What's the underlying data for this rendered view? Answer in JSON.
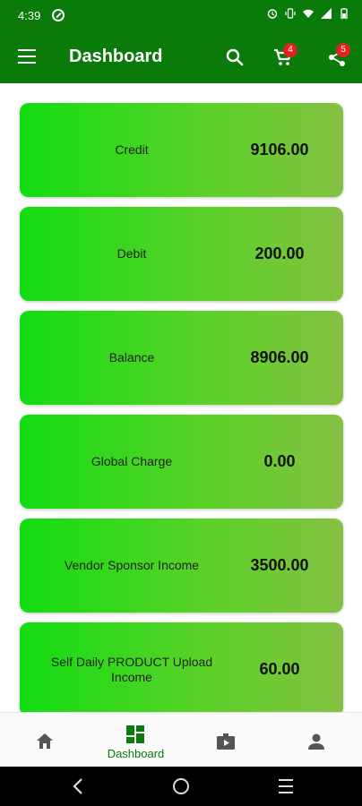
{
  "status_bar": {
    "time": "4:39",
    "icons": [
      "dnd-icon",
      "alarm-icon",
      "vibrate-icon",
      "wifi-icon",
      "signal-icon",
      "battery-icon"
    ]
  },
  "app_bar": {
    "title": "Dashboard",
    "cart_badge": "4",
    "share_badge": "5",
    "background": "#0a7a0a"
  },
  "cards": [
    {
      "label": "Credit",
      "value": "9106.00"
    },
    {
      "label": "Debit",
      "value": "200.00"
    },
    {
      "label": "Balance",
      "value": "8906.00"
    },
    {
      "label": "Global Charge",
      "value": "0.00"
    },
    {
      "label": "Vendor Sponsor Income",
      "value": "3500.00"
    },
    {
      "label": "Self Daily PRODUCT Upload Income",
      "value": "60.00"
    }
  ],
  "bottom_nav": {
    "items": [
      {
        "icon": "home-icon",
        "label": ""
      },
      {
        "icon": "dashboard-icon",
        "label": "Dashboard",
        "active": true
      },
      {
        "icon": "video-icon",
        "label": ""
      },
      {
        "icon": "person-icon",
        "label": ""
      }
    ]
  },
  "colors": {
    "primary": "#0a7a0a",
    "card_gradient_start": "#12dd12",
    "card_gradient_end": "#84c141",
    "badge": "#e32121"
  }
}
